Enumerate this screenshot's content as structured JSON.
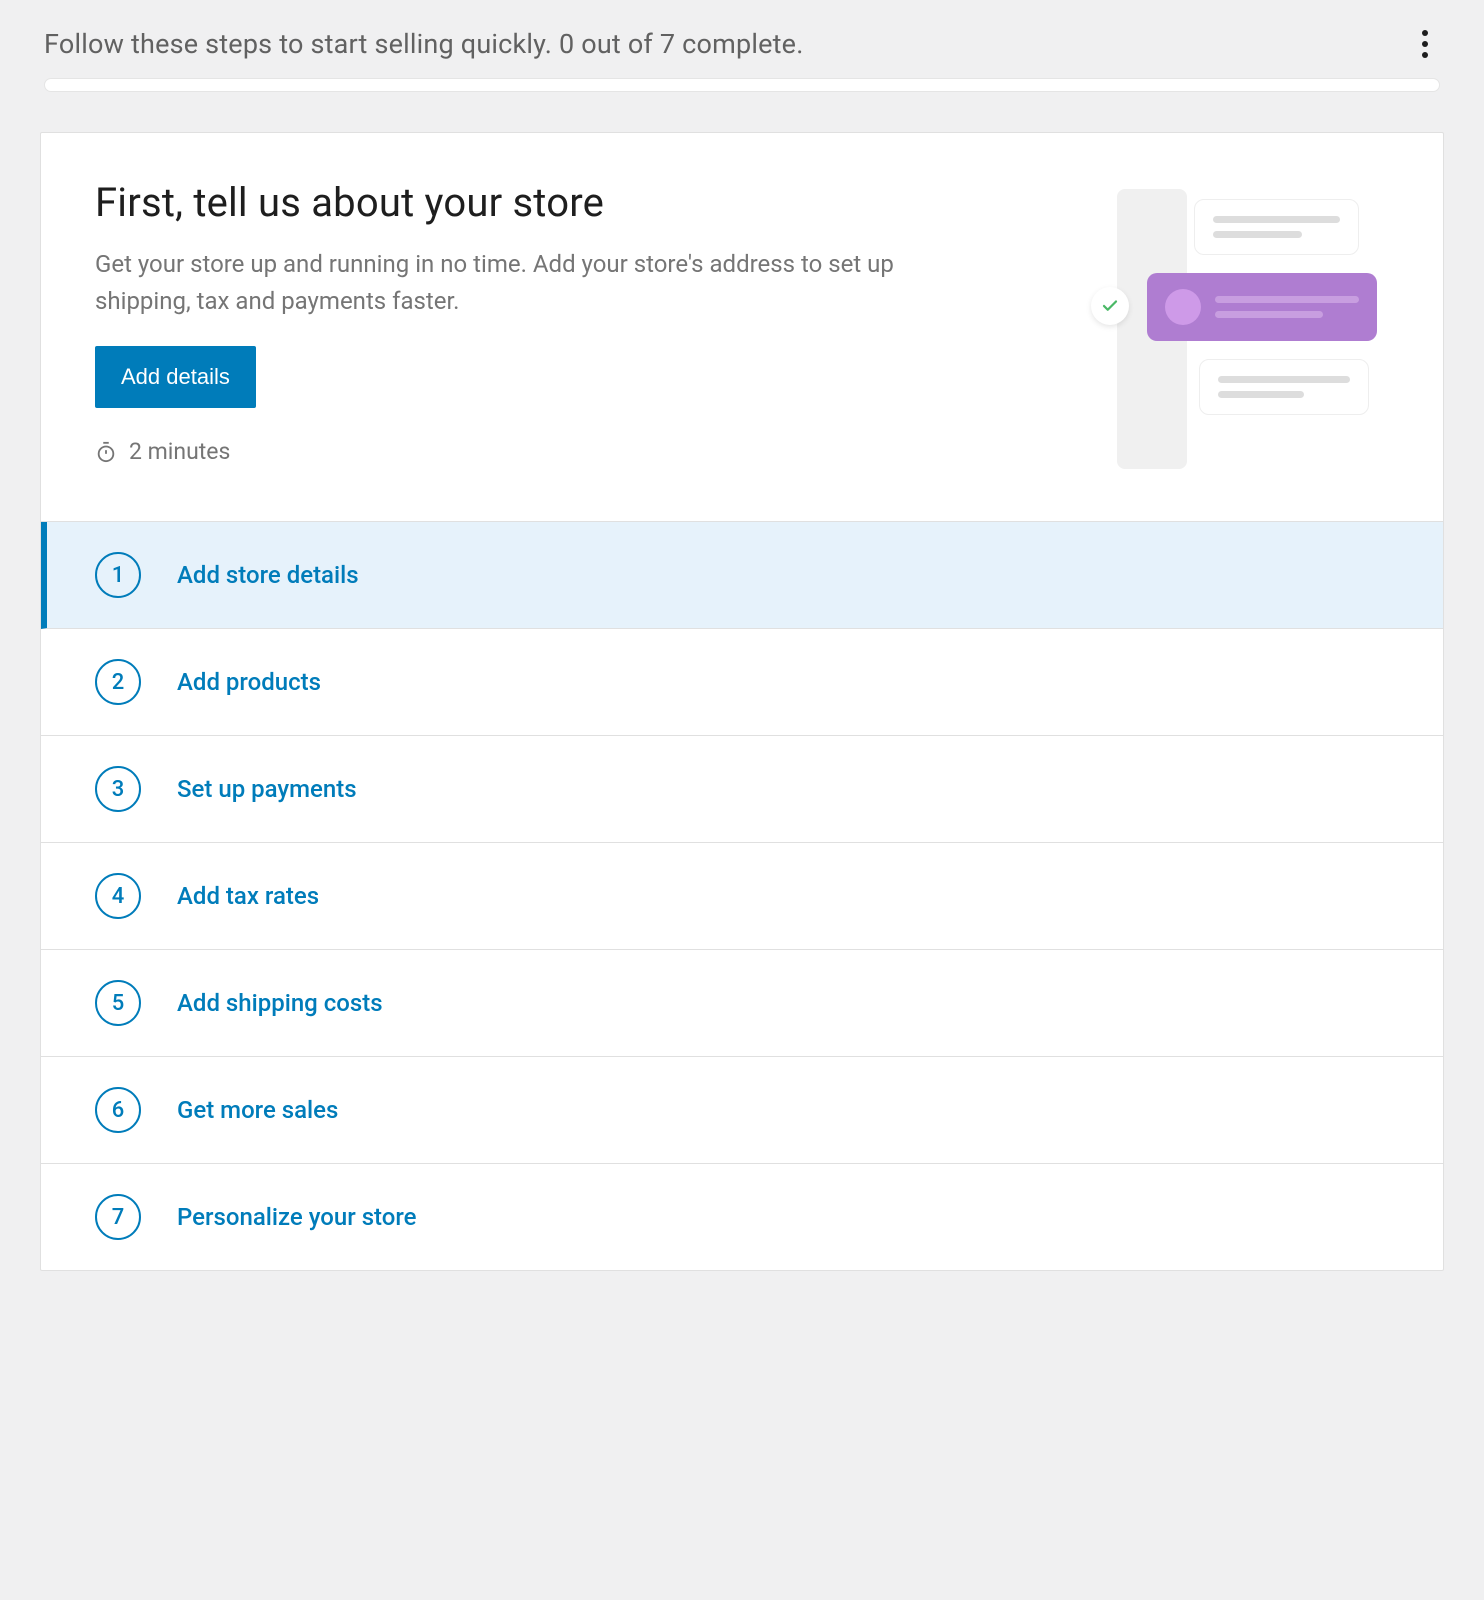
{
  "header": {
    "subtitle": "Follow these steps to start selling quickly. 0 out of 7 complete."
  },
  "hero": {
    "title": "First, tell us about your store",
    "description": "Get your store up and running in no time. Add your store's address to set up shipping, tax and payments faster.",
    "button_label": "Add details",
    "time_estimate": "2 minutes"
  },
  "tasks": [
    {
      "number": "1",
      "label": "Add store details",
      "active": true
    },
    {
      "number": "2",
      "label": "Add products",
      "active": false
    },
    {
      "number": "3",
      "label": "Set up payments",
      "active": false
    },
    {
      "number": "4",
      "label": "Add tax rates",
      "active": false
    },
    {
      "number": "5",
      "label": "Add shipping costs",
      "active": false
    },
    {
      "number": "6",
      "label": "Get more sales",
      "active": false
    },
    {
      "number": "7",
      "label": "Personalize your store",
      "active": false
    }
  ]
}
